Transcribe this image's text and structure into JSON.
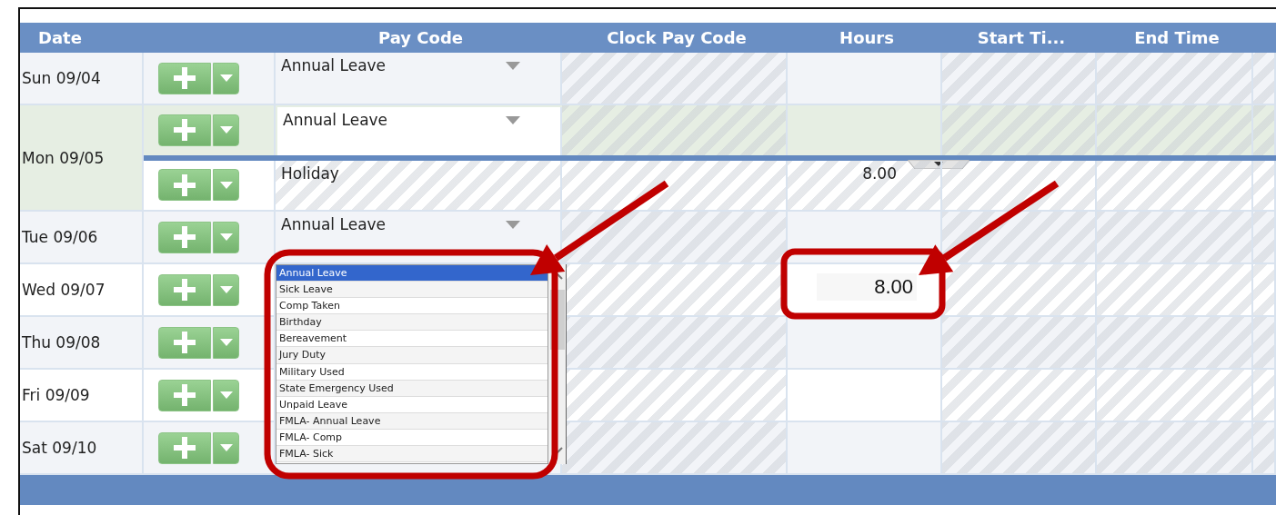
{
  "table": {
    "columns": [
      "Date",
      "Pay Code",
      "Clock Pay Code",
      "Hours",
      "Start Ti...",
      "End Time"
    ],
    "rows": [
      {
        "date": "Sun 09/04",
        "selected": false,
        "entries": [
          {
            "kind": "select",
            "pay_code": "Annual Leave"
          }
        ]
      },
      {
        "date": "Mon 09/05",
        "selected": true,
        "entries": [
          {
            "kind": "select",
            "pay_code": "Annual Leave"
          },
          {
            "kind": "locked",
            "pay_code": "Holiday",
            "hours": "8.00"
          }
        ]
      },
      {
        "date": "Tue 09/06",
        "selected": false,
        "entries": [
          {
            "kind": "select",
            "pay_code": "Annual Leave"
          }
        ]
      },
      {
        "date": "Wed 09/07",
        "selected": false,
        "entries": [
          {
            "kind": "open",
            "hours": "8.00",
            "options": [
              {
                "label": "Annual Leave",
                "selected": true
              },
              {
                "label": "Sick Leave",
                "selected": false
              },
              {
                "label": "Comp Taken",
                "selected": false
              },
              {
                "label": "Birthday",
                "selected": false
              },
              {
                "label": "Bereavement",
                "selected": false
              },
              {
                "label": "Jury Duty",
                "selected": false
              },
              {
                "label": "Military Used",
                "selected": false
              },
              {
                "label": "State Emergency Used",
                "selected": false
              },
              {
                "label": "Unpaid Leave",
                "selected": false
              },
              {
                "label": "FMLA- Annual Leave",
                "selected": false
              },
              {
                "label": "FMLA- Comp",
                "selected": false
              },
              {
                "label": "FMLA- Sick",
                "selected": false
              }
            ]
          }
        ]
      },
      {
        "date": "Thu 09/08",
        "selected": false,
        "entries": [
          {
            "kind": "empty"
          }
        ]
      },
      {
        "date": "Fri 09/09",
        "selected": false,
        "entries": [
          {
            "kind": "empty"
          }
        ]
      },
      {
        "date": "Sat 09/10",
        "selected": false,
        "entries": [
          {
            "kind": "empty"
          }
        ]
      }
    ]
  }
}
